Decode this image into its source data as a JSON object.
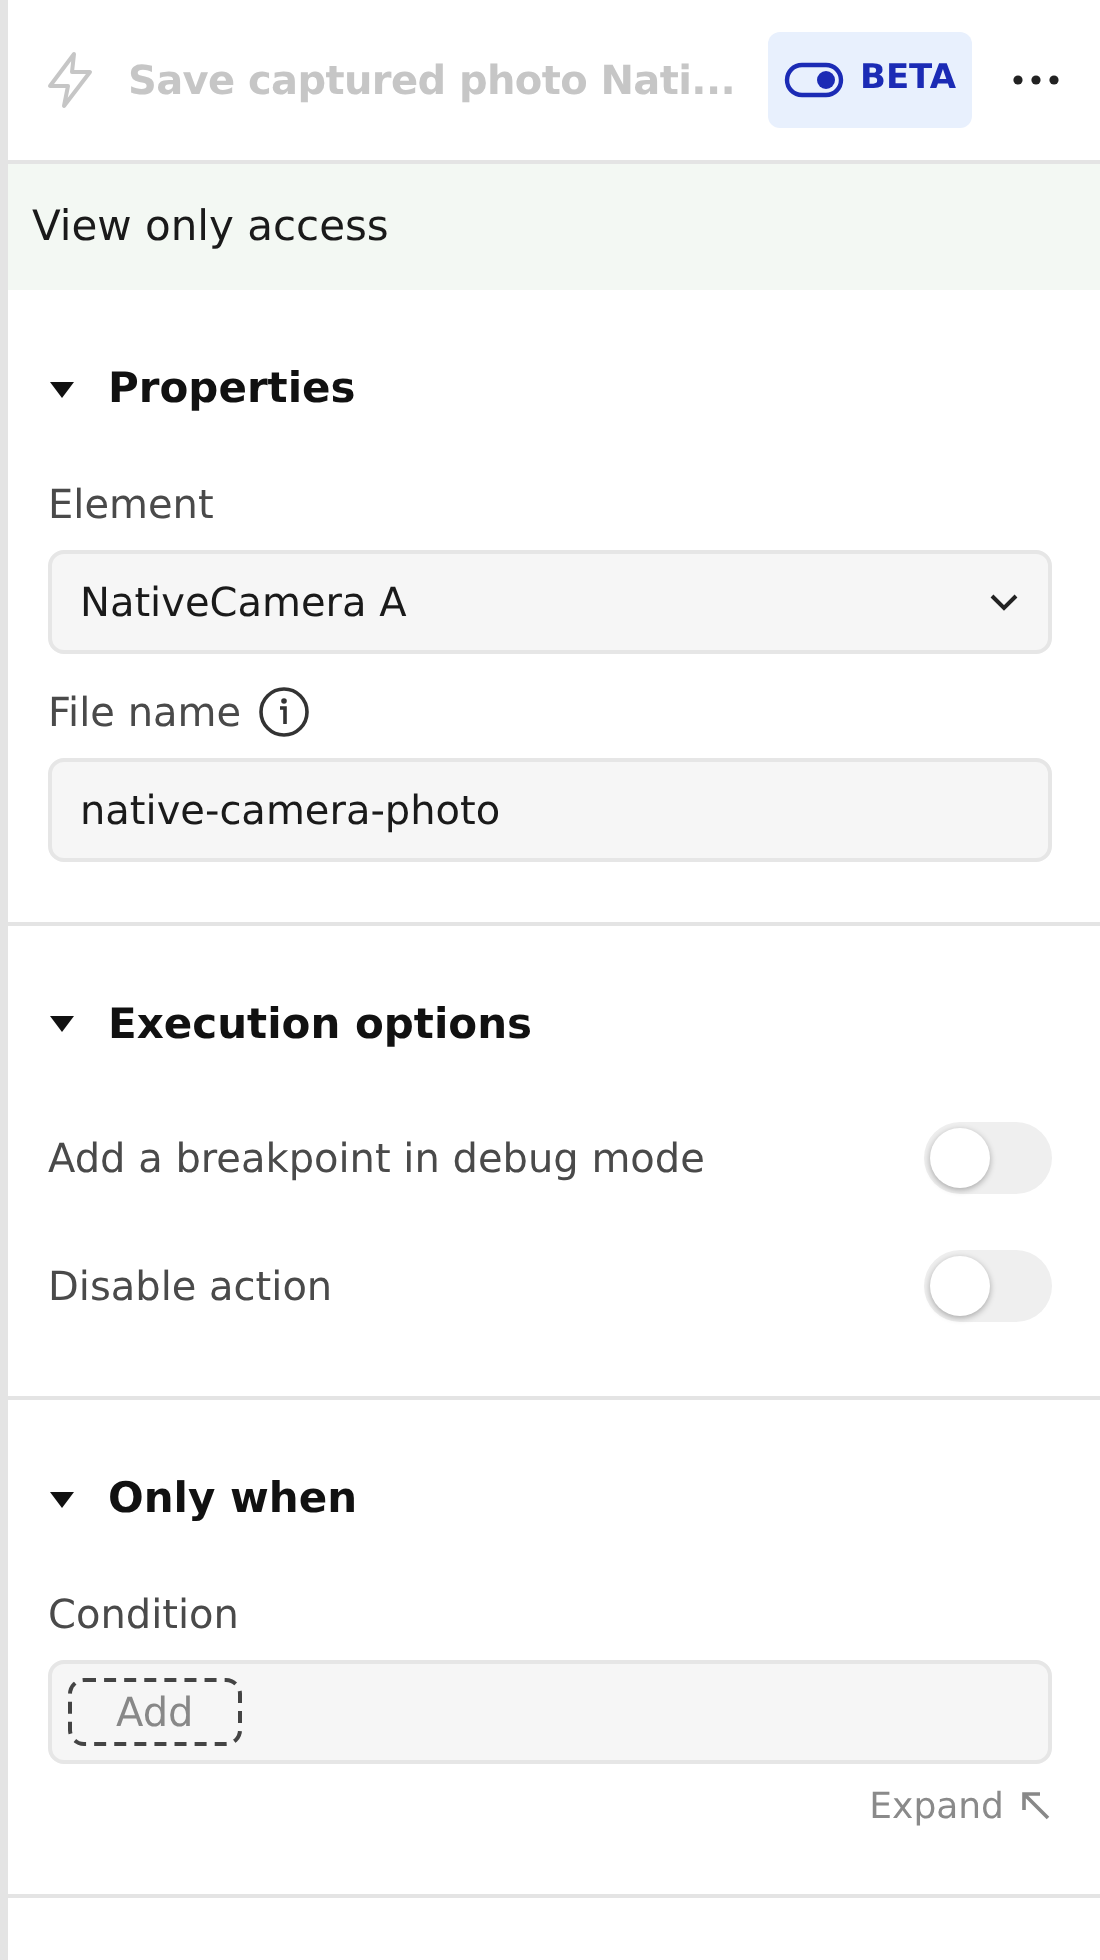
{
  "header": {
    "title": "Save captured photo Nati...",
    "disabled": true,
    "badge": "BETA"
  },
  "notice": "View only access",
  "sections": [
    {
      "title": "Properties",
      "expanded": true,
      "fields": [
        {
          "kind": "select",
          "label": "Element",
          "value": "NativeCamera A"
        },
        {
          "kind": "text",
          "label": "File name",
          "info": true,
          "value": "native-camera-photo"
        }
      ]
    },
    {
      "title": "Execution options",
      "expanded": true,
      "fields": [
        {
          "kind": "switch",
          "label": "Add a breakpoint in debug mode",
          "on": false
        },
        {
          "kind": "switch",
          "label": "Disable action",
          "on": false
        }
      ]
    },
    {
      "title": "Only when",
      "expanded": true,
      "fields": [
        {
          "kind": "condition",
          "label": "Condition",
          "button": "Add",
          "link": "Expand"
        }
      ]
    }
  ]
}
